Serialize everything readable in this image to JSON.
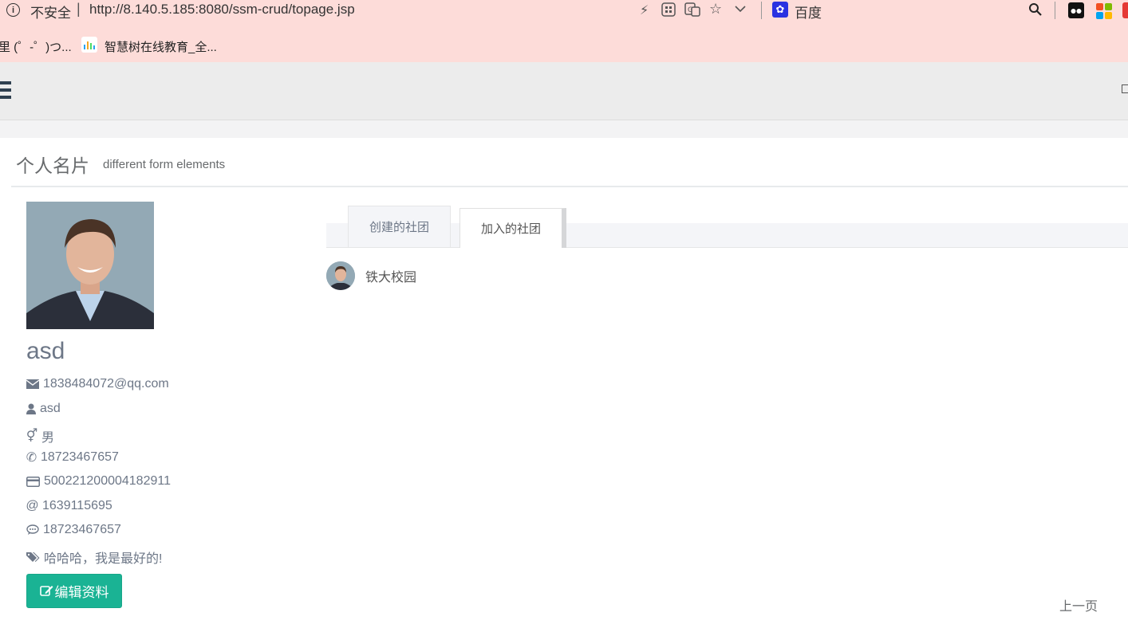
{
  "browser": {
    "insecure_label": "不安全",
    "url": "http://8.140.5.185:8080/ssm-crud/topage.jsp",
    "search_engine": "百度"
  },
  "bookmarks": [
    {
      "label": "里 (゜-゜)つ..."
    },
    {
      "label": "智慧树在线教育_全..."
    }
  ],
  "page": {
    "title": "个人名片",
    "subtitle": "different form elements"
  },
  "profile": {
    "name": "asd",
    "email": "1838484072@qq.com",
    "username": "asd",
    "gender": "男",
    "phone": "18723467657",
    "id_card": "500221200004182911",
    "qq": "1639115695",
    "wechat": "18723467657",
    "motto": "哈哈哈，我是最好的!",
    "edit_label": "编辑资料"
  },
  "tabs": {
    "created": "创建的社团",
    "joined": "加入的社团"
  },
  "clubs": [
    {
      "name": "铁大校园"
    }
  ],
  "pagination": {
    "prev_label": "上一页"
  },
  "colors": {
    "accent": "#1ab394",
    "browser_bar": "#fddcd9",
    "header_bg": "#ececec"
  }
}
